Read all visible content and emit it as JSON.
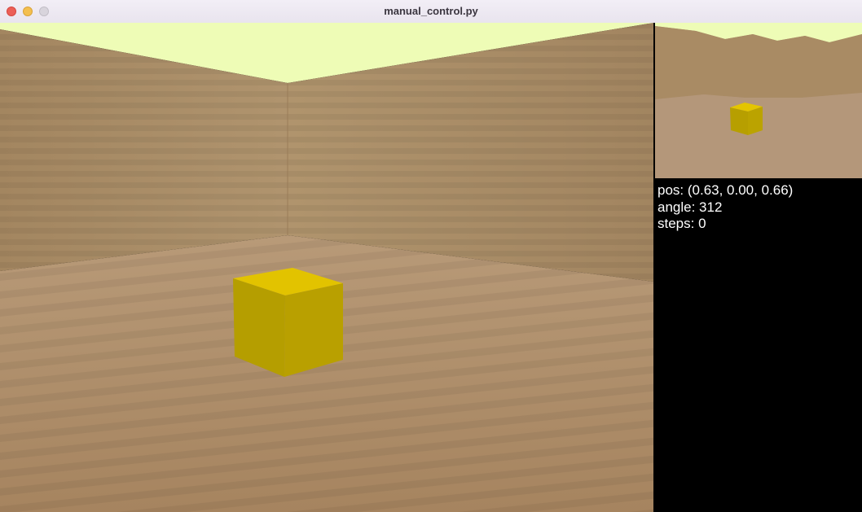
{
  "window": {
    "title": "manual_control.py"
  },
  "scene": {
    "sky_color": "#eefcb6",
    "wall_color": "#a88a61",
    "floor_color": "#b08d6a",
    "box_color": "#e3c400",
    "objects": [
      "yellow-box"
    ]
  },
  "stats": {
    "pos": "pos: (0.63, 0.00, 0.66)",
    "angle": "angle: 312",
    "steps": "steps: 0"
  }
}
